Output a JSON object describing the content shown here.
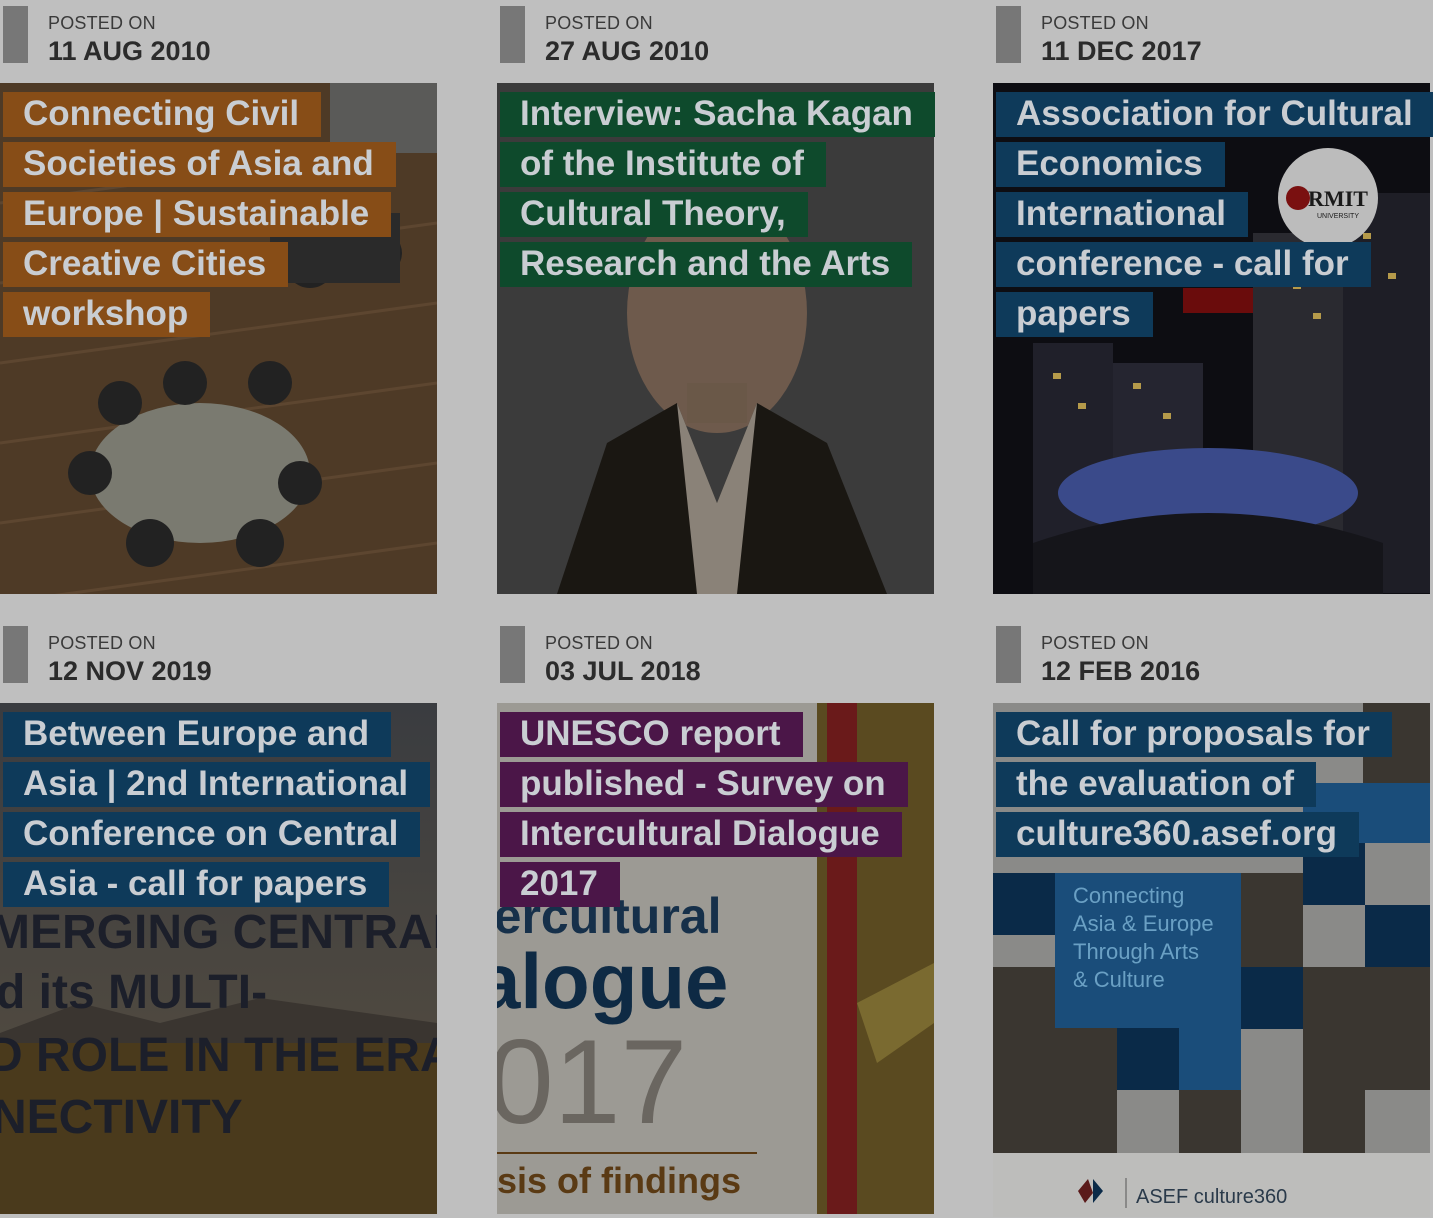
{
  "posts": [
    {
      "posted_label": "POSTED ON",
      "date": "11 AUG 2010",
      "title": "Connecting Civil Societies of Asia and Europe | Sustainable Creative Cities workshop",
      "category_color": "#874d17"
    },
    {
      "posted_label": "POSTED ON",
      "date": "27 AUG 2010",
      "title": "Interview: Sacha Kagan of the Institute of Cultural Theory, Research and the Arts",
      "category_color": "#0e4a2c"
    },
    {
      "posted_label": "POSTED ON",
      "date": "11 DEC 2017",
      "title": "Association for Cultural Economics International conference - call for papers",
      "category_color": "#0e3a5a"
    },
    {
      "posted_label": "POSTED ON",
      "date": "12 NOV 2019",
      "title": "Between Europe and Asia | 2nd International Conference on Central Asia - call for papers",
      "category_color": "#0e3a5a"
    },
    {
      "posted_label": "POSTED ON",
      "date": "03 JUL 2018",
      "title": "UNESCO report published - Survey on Intercultural Dialogue 2017",
      "category_color": "#4b1648"
    },
    {
      "posted_label": "POSTED ON",
      "date": "12 FEB 2016",
      "title": "Call for proposals for the evaluation of culture360.asef.org",
      "category_color": "#0e3a5a"
    }
  ],
  "image_text": {
    "rmit_logo": "RMIT",
    "rmit_sub": "UNIVERSITY",
    "central_asia_lines": [
      "MERGING CENTRAL",
      "d its MULTI-",
      "D ROLE IN THE ERA",
      "NECTIVITY"
    ],
    "unesco_lines": [
      "tercultural",
      "alogue",
      "017",
      "sis of findings"
    ],
    "asef_tagline": [
      "Connecting",
      "Asia & Europe",
      "Through Arts",
      "& Culture"
    ],
    "asef_brand": "ASEF culture360"
  }
}
